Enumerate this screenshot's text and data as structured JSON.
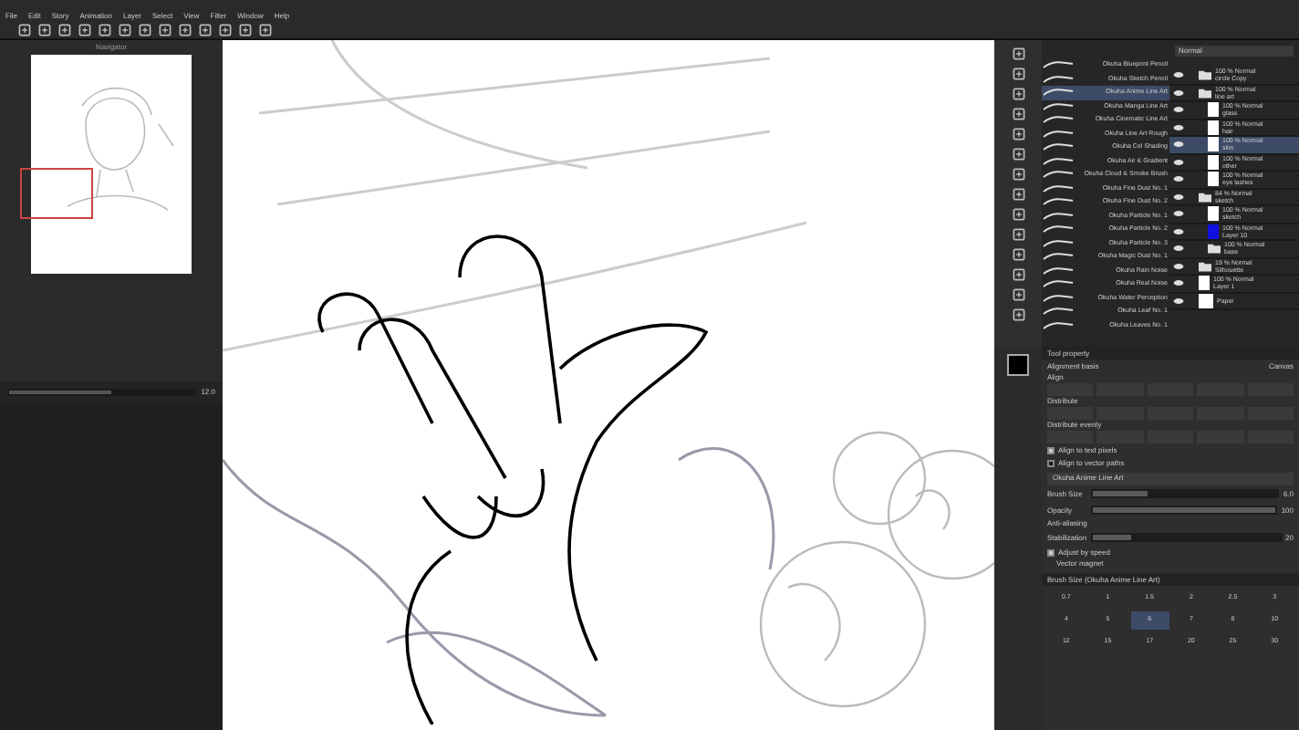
{
  "menu": [
    "File",
    "Edit",
    "Story",
    "Animation",
    "Layer",
    "Select",
    "View",
    "Filter",
    "Window",
    "Help"
  ],
  "navigator": {
    "title": "Navigator",
    "zoom": "12.0",
    "level": 0.55
  },
  "brushes": [
    {
      "name": "Okuha Blueprint Pencil",
      "selected": false
    },
    {
      "name": "Okuha Sketch Pencil",
      "selected": false
    },
    {
      "name": "Okuha Anime Line Art",
      "selected": true
    },
    {
      "name": "Okuha Manga Line Art",
      "selected": false
    },
    {
      "name": "Okuha Cinematic Line Art",
      "selected": false
    },
    {
      "name": "Okuha Line Art Rough",
      "selected": false
    },
    {
      "name": "Okuha Cel Shading",
      "selected": false
    },
    {
      "name": "Okuha Air & Gradient",
      "selected": false
    },
    {
      "name": "Okuha Cloud & Smoke Brush",
      "selected": false
    },
    {
      "name": "Okuha Fine Dust No. 1",
      "selected": false
    },
    {
      "name": "Okuha Fine Dust No. 2",
      "selected": false
    },
    {
      "name": "Okuha Particle No. 1",
      "selected": false
    },
    {
      "name": "Okuha Particle No. 2",
      "selected": false
    },
    {
      "name": "Okuha Particle No. 3",
      "selected": false
    },
    {
      "name": "Okuha Magic Dust No. 1",
      "selected": false
    },
    {
      "name": "Okuha Rain Noise",
      "selected": false
    },
    {
      "name": "Okuha Real Noise",
      "selected": false
    },
    {
      "name": "Okuha Water Perception",
      "selected": false
    },
    {
      "name": "Okuha Leaf No. 1",
      "selected": false
    },
    {
      "name": "Okuha Leaves No. 1",
      "selected": false
    }
  ],
  "layers": {
    "blend": "Normal",
    "items": [
      {
        "mode": "100 % Normal",
        "name": "circle Copy",
        "kind": "folder",
        "selected": false
      },
      {
        "mode": "100 % Normal",
        "name": "line art",
        "kind": "folder",
        "selected": false,
        "children": [
          {
            "mode": "100 % Normal",
            "name": "glass",
            "kind": "layer",
            "selected": false
          },
          {
            "mode": "100 % Normal",
            "name": "hair",
            "kind": "layer",
            "selected": false
          },
          {
            "mode": "100 % Normal",
            "name": "skin",
            "kind": "layer",
            "selected": true
          },
          {
            "mode": "100 % Normal",
            "name": "other",
            "kind": "layer",
            "selected": false
          },
          {
            "mode": "100 % Normal",
            "name": "eye lashes",
            "kind": "layer",
            "selected": false
          }
        ]
      },
      {
        "mode": "84 % Normal",
        "name": "sketch",
        "kind": "folder",
        "selected": false,
        "children": [
          {
            "mode": "100 % Normal",
            "name": "sketch",
            "kind": "layer",
            "selected": false
          },
          {
            "mode": "100 % Normal",
            "name": "Layer 10",
            "kind": "fill",
            "selected": false
          },
          {
            "mode": "100 % Normal",
            "name": "base",
            "kind": "folder",
            "selected": false
          }
        ]
      },
      {
        "mode": "19 % Normal",
        "name": "Silhouette",
        "kind": "folder",
        "selected": false
      },
      {
        "mode": "100 % Normal",
        "name": "Layer 1",
        "kind": "layer",
        "selected": false
      },
      {
        "name": "Paper",
        "kind": "paper",
        "selected": false
      }
    ]
  },
  "tool_property": {
    "title": "Tool property",
    "alignment_basis": "Alignment basis",
    "canvas": "Canvas",
    "sections": [
      "Align",
      "Distribute",
      "Distribute evenly"
    ],
    "checks": [
      {
        "label": "Align to text pixels",
        "checked": true
      },
      {
        "label": "Align to vector paths",
        "checked": false
      }
    ],
    "brush": "Okuha Anime Line Art",
    "sliders": [
      {
        "label": "Brush Size",
        "value": "6.0",
        "level": 0.3
      },
      {
        "label": "Opacity",
        "value": "100",
        "level": 1
      }
    ],
    "antialiasing": "Anti-aliasing",
    "stabilization": {
      "label": "Stabilization",
      "value": "20",
      "level": 0.2
    },
    "adjust_by_speed": {
      "label": "Adjust by speed",
      "checked": true
    },
    "vector_magnet": "Vector magnet"
  },
  "brush_size": {
    "title": "Brush Size (Okuha Anime Line Art)",
    "sizes": [
      {
        "label": "0.7",
        "selected": false
      },
      {
        "label": "1",
        "selected": false
      },
      {
        "label": "1.5",
        "selected": false
      },
      {
        "label": "2",
        "selected": false
      },
      {
        "label": "2.5",
        "selected": false
      },
      {
        "label": "3",
        "selected": false
      },
      {
        "label": "4",
        "selected": false
      },
      {
        "label": "5",
        "selected": false
      },
      {
        "label": "6",
        "selected": true
      },
      {
        "label": "7",
        "selected": false
      },
      {
        "label": "8",
        "selected": false
      },
      {
        "label": "10",
        "selected": false
      },
      {
        "label": "12",
        "selected": false
      },
      {
        "label": "15",
        "selected": false
      },
      {
        "label": "17",
        "selected": false
      },
      {
        "label": "20",
        "selected": false
      },
      {
        "label": "25",
        "selected": false
      },
      {
        "label": "30",
        "selected": false
      }
    ]
  }
}
